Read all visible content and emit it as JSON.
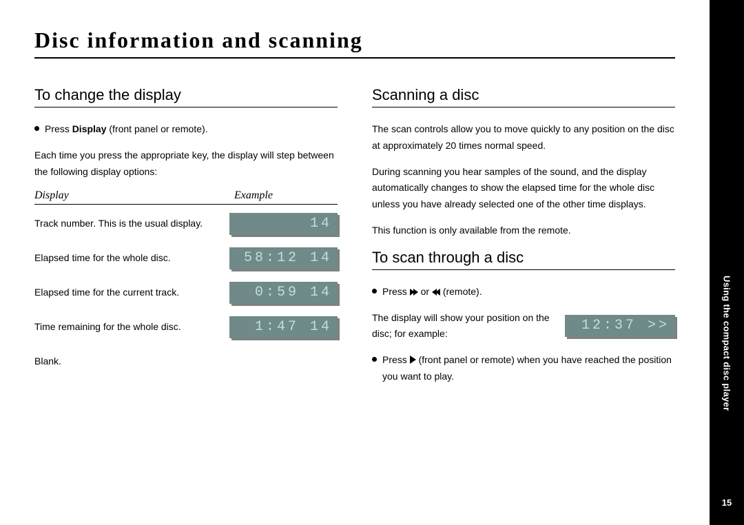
{
  "title": "Disc information and scanning",
  "sidebar": {
    "chapter": "Using the compact disc player",
    "page": "15"
  },
  "left": {
    "heading": "To change the display",
    "bullet1_pre": "Press ",
    "bullet1_bold": "Display",
    "bullet1_post": " (front panel or remote).",
    "para1": "Each time you press the appropriate key, the display will step between the following display options:",
    "table": {
      "header_left": "Display",
      "header_right": "Example",
      "rows": [
        {
          "desc": "Track number. This is the usual display.",
          "lcd": "14"
        },
        {
          "desc": "Elapsed time for the whole disc.",
          "lcd": "58:12 14"
        },
        {
          "desc": "Elapsed time for the current track.",
          "lcd": "0:59 14"
        },
        {
          "desc": "Time remaining for the whole disc.",
          "lcd": "1:47 14"
        },
        {
          "desc": "Blank.",
          "lcd": ""
        }
      ]
    }
  },
  "right": {
    "heading1": "Scanning a disc",
    "para1": "The scan controls allow you to move quickly to any position on the disc at approximately 20 times normal speed.",
    "para2": "During scanning you hear samples of the sound, and the display automatically changes to show the elapsed time for the whole disc unless you have already selected one of the other time displays.",
    "para3": "This function is only available from the remote.",
    "heading2": "To scan through a disc",
    "bullet1_pre": "Press ",
    "bullet1_mid": "or ",
    "bullet1_post": "(remote).",
    "inline": {
      "text": "The display will show your position on the disc; for example:",
      "lcd": "12:37 >>"
    },
    "bullet2_pre": "Press ",
    "bullet2_post": "(front panel or remote) when you have reached the position you want to play."
  }
}
